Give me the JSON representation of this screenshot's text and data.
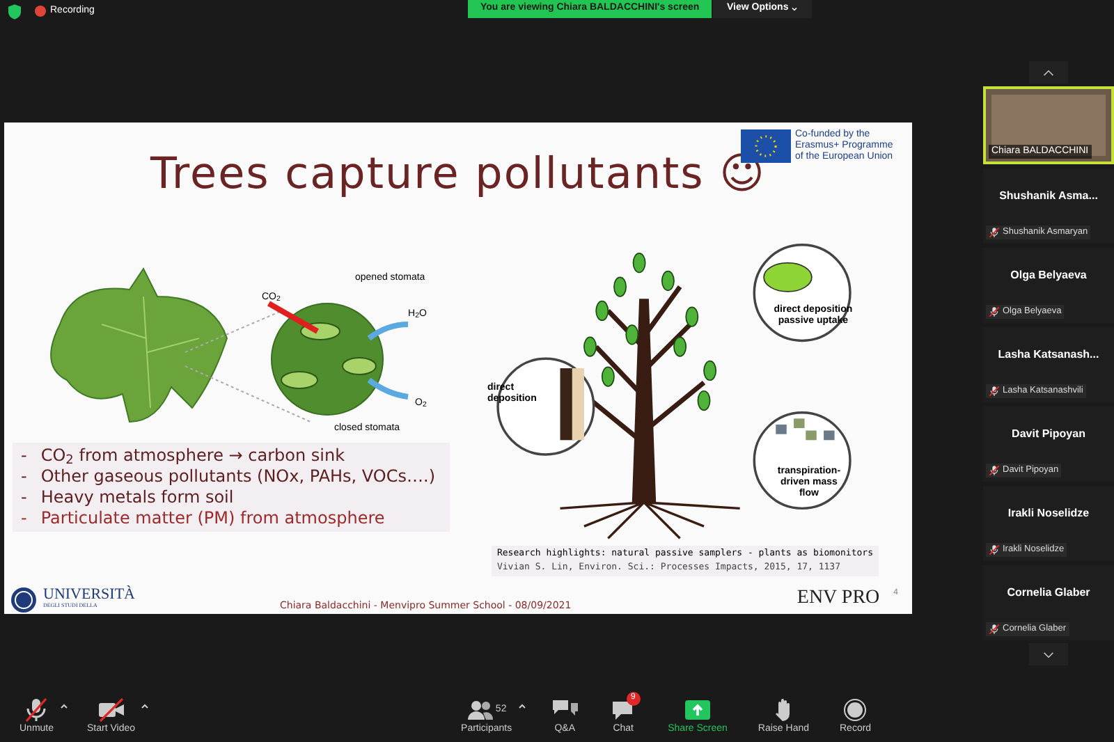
{
  "top_bar": {
    "recording": "Recording",
    "viewing_banner": "You are viewing Chiara BALDACCHINI's screen",
    "view_options": "View Options"
  },
  "slide": {
    "title": "Trees capture pollutants ☺",
    "funding": "Co-funded by the Erasmus+ Programme of the European Union",
    "leaf_labels": {
      "co2": "CO$_{2}$",
      "opened": "opened stomata",
      "h2o": "H$_{2}$O",
      "o2": "O$_{2}$",
      "closed": "closed stomata"
    },
    "bullets": [
      {
        "marker": "-",
        "text": "CO$_{2}$ from atmosphere → carbon sink",
        "color": "#5c1e1e"
      },
      {
        "marker": "-",
        "text": "Other gaseous pollutants (NOx, PAHs, VOCs….)",
        "color": "#5c1e1e"
      },
      {
        "marker": "-",
        "text": "Heavy metals form soil",
        "color": "#5c1e1e"
      },
      {
        "marker": "-",
        "text": "Particulate matter (PM) from atmosphere",
        "color": "#9b2b2b"
      }
    ],
    "tree_labels": {
      "uptake": "direct deposition passive uptake",
      "deposition": "direct deposition",
      "mass_flow": "transpiration-driven mass flow"
    },
    "reference": {
      "title": "Research highlights: natural passive samplers - plants as biomonitors",
      "citation": "Vivian S. Lin, Environ. Sci.: Processes Impacts, 2015, 17, 1137"
    },
    "university": {
      "name": "UNIVERSITÀ",
      "subtitle": "DEGLI STUDI DELLA"
    },
    "footer": "Chiara Baldacchini - Menvipro Summer School - 08/09/2021",
    "project_logo": "ENV PRO",
    "page": "4"
  },
  "participants": [
    {
      "kind": "video",
      "name": "Chiara BALDACCHINI",
      "selected": true
    },
    {
      "kind": "name",
      "title": "Shushanik  Asma...",
      "name": "Shushanik Asmaryan",
      "muted": true
    },
    {
      "kind": "name",
      "title": "Olga Belyaeva",
      "name": "Olga Belyaeva",
      "muted": true
    },
    {
      "kind": "name",
      "title": "Lasha  Katsanash...",
      "name": "Lasha Katsanashvili",
      "muted": true
    },
    {
      "kind": "name",
      "title": "Davit Pipoyan",
      "name": "Davit Pipoyan",
      "muted": true
    },
    {
      "kind": "name",
      "title": "Irakli Noselidze",
      "name": "Irakli Noselidze",
      "muted": true
    },
    {
      "kind": "name",
      "title": "Cornelia Glaber",
      "name": "Cornelia Glaber",
      "muted": true
    }
  ],
  "toolbar": [
    {
      "kind": "mic",
      "label": "Unmute",
      "off": true,
      "menu": true
    },
    {
      "kind": "video",
      "label": "Start Video",
      "off": true,
      "menu": true
    },
    {
      "kind": "participants",
      "label": "Participants",
      "count": "52",
      "menu": true
    },
    {
      "kind": "qa",
      "label": "Q&A"
    },
    {
      "kind": "chat",
      "label": "Chat",
      "badge": "9"
    },
    {
      "kind": "share",
      "label": "Share Screen"
    },
    {
      "kind": "hand",
      "label": "Raise Hand"
    },
    {
      "kind": "record",
      "label": "Record"
    }
  ]
}
